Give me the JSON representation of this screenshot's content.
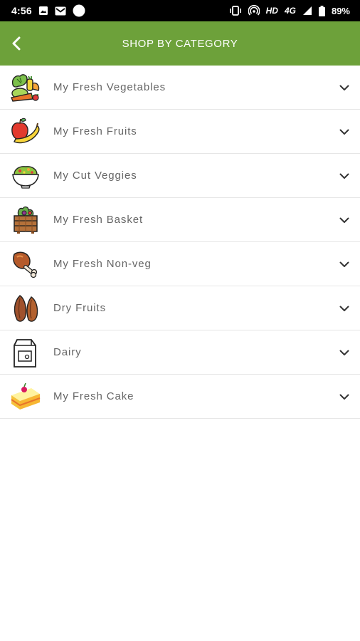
{
  "status_bar": {
    "time": "4:56",
    "left_icons": [
      "image-icon",
      "gmail-icon",
      "circle-dot-icon"
    ],
    "network": "HD",
    "signal_label": "4G",
    "battery": "89%"
  },
  "header": {
    "title": "SHOP BY CATEGORY",
    "background_color": "#6da13a",
    "back_icon": "chevron-left-icon"
  },
  "categories": [
    {
      "label": "My Fresh Vegetables",
      "icon": "vegetables-icon"
    },
    {
      "label": "My Fresh Fruits",
      "icon": "fruits-icon"
    },
    {
      "label": "My Cut Veggies",
      "icon": "salad-bowl-icon"
    },
    {
      "label": "My Fresh Basket",
      "icon": "basket-icon"
    },
    {
      "label": "My Fresh Non-veg",
      "icon": "chicken-leg-icon"
    },
    {
      "label": "Dry Fruits",
      "icon": "almond-icon"
    },
    {
      "label": "Dairy",
      "icon": "milk-carton-icon"
    },
    {
      "label": "My Fresh Cake",
      "icon": "cake-icon"
    }
  ]
}
